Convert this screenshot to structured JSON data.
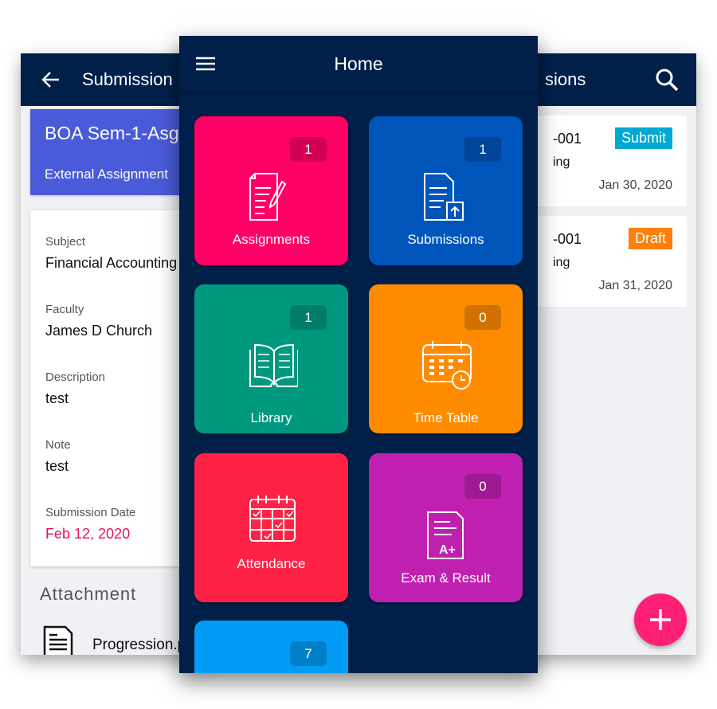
{
  "left_screen": {
    "title": "Submission",
    "card_title": "BOA Sem-1-Asg",
    "card_subtitle": "External Assignment",
    "card_color": "#4a5bd9",
    "fields": [
      {
        "label": "Subject",
        "value": "Financial Accounting"
      },
      {
        "label": "Faculty",
        "value": "James D Church"
      },
      {
        "label": "Description",
        "value": "test"
      },
      {
        "label": "Note",
        "value": "test"
      },
      {
        "label": "Submission Date",
        "value": "Feb 12, 2020"
      }
    ],
    "attachment_heading": "Attachment",
    "attachment_file": "Progression.p"
  },
  "right_screen": {
    "title": "sions",
    "items": [
      {
        "code": "-001",
        "subject": "ing",
        "status": "Submit",
        "status_color": "#00a9d4",
        "date": "Jan 30, 2020"
      },
      {
        "code": "-001",
        "subject": "ing",
        "status": "Draft",
        "status_color": "#ff7f0a",
        "date": "Jan 31, 2020"
      }
    ]
  },
  "home": {
    "title": "Home",
    "tiles": [
      {
        "label": "Assignments",
        "count": "1",
        "color": "#ff0066",
        "icon": "assignment-icon"
      },
      {
        "label": "Submissions",
        "count": "1",
        "color": "#0055bb",
        "icon": "submission-icon"
      },
      {
        "label": "Library",
        "count": "1",
        "color": "#009980",
        "icon": "book-icon"
      },
      {
        "label": "Time Table",
        "count": "0",
        "color": "#ff8c00",
        "icon": "calendar-clock-icon"
      },
      {
        "label": "Attendance",
        "count": "",
        "color": "#ff2244",
        "icon": "attendance-calendar-icon"
      },
      {
        "label": "Exam & Result",
        "count": "0",
        "color": "#c020b0",
        "icon": "exam-result-icon"
      },
      {
        "label": "",
        "count": "7",
        "color": "#009cf5",
        "icon": ""
      }
    ]
  },
  "fab": {
    "icon": "plus-icon",
    "color": "#ff1f77"
  }
}
